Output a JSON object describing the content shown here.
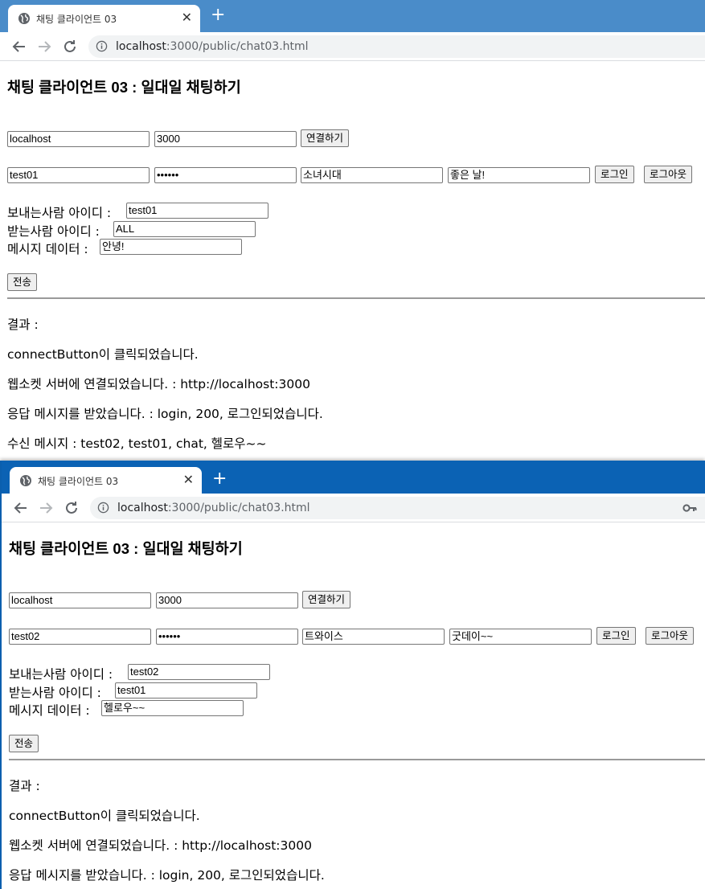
{
  "windows": [
    {
      "tab_title": "채팅 클라이언트 03",
      "url_host": "localhost",
      "url_path": ":3000/public/chat03.html",
      "page_title": "채팅 클라이언트 03 : 일대일 채팅하기",
      "host_value": "localhost",
      "port_value": "3000",
      "connect_label": "연결하기",
      "id_value": "test01",
      "password_value": "••••••",
      "alias_value": "소녀시대",
      "today_value": "좋은 날!",
      "login_label": "로그인",
      "logout_label": "로그아웃",
      "sender_label": "보내는사람 아이디 :",
      "sender_value": "test01",
      "recipient_label": "받는사람 아이디 :",
      "recipient_value": "ALL",
      "message_label": "메시지 데이터 :",
      "message_value": "안녕!",
      "send_label": "전송",
      "results": [
        "결과 :",
        "connectButton이 클릭되었습니다.",
        "웹소켓 서버에 연결되었습니다. : http://localhost:3000",
        "응답 메시지를 받았습니다. : login, 200, 로그인되었습니다.",
        "수신 메시지 : test02, test01, chat, 헬로우~~"
      ]
    },
    {
      "tab_title": "채팅 클라이언트 03",
      "url_host": "localhost",
      "url_path": ":3000/public/chat03.html",
      "page_title": "채팅 클라이언트 03 : 일대일 채팅하기",
      "host_value": "localhost",
      "port_value": "3000",
      "connect_label": "연결하기",
      "id_value": "test02",
      "password_value": "••••••",
      "alias_value": "트와이스",
      "today_value": "굿데이~~",
      "login_label": "로그인",
      "logout_label": "로그아웃",
      "sender_label": "보내는사람 아이디 :",
      "sender_value": "test02",
      "recipient_label": "받는사람 아이디 :",
      "recipient_value": "test01",
      "message_label": "메시지 데이터 :",
      "message_value": "헬로우~~",
      "send_label": "전송",
      "results": [
        "결과 :",
        "connectButton이 클릭되었습니다.",
        "웹소켓 서버에 연결되었습니다. : http://localhost:3000",
        "응답 메시지를 받았습니다. : login, 200, 로그인되었습니다."
      ]
    }
  ],
  "colors": {
    "tabstrip_back": "#4a8cc9",
    "tabstrip_front": "#0b62b4"
  },
  "icons": {
    "tab": "globe-icon",
    "close": "close-icon",
    "new_tab": "plus-icon",
    "back": "arrow-left-icon",
    "forward": "arrow-right-icon",
    "reload": "reload-icon",
    "site_info": "info-icon",
    "password_key": "key-icon"
  }
}
